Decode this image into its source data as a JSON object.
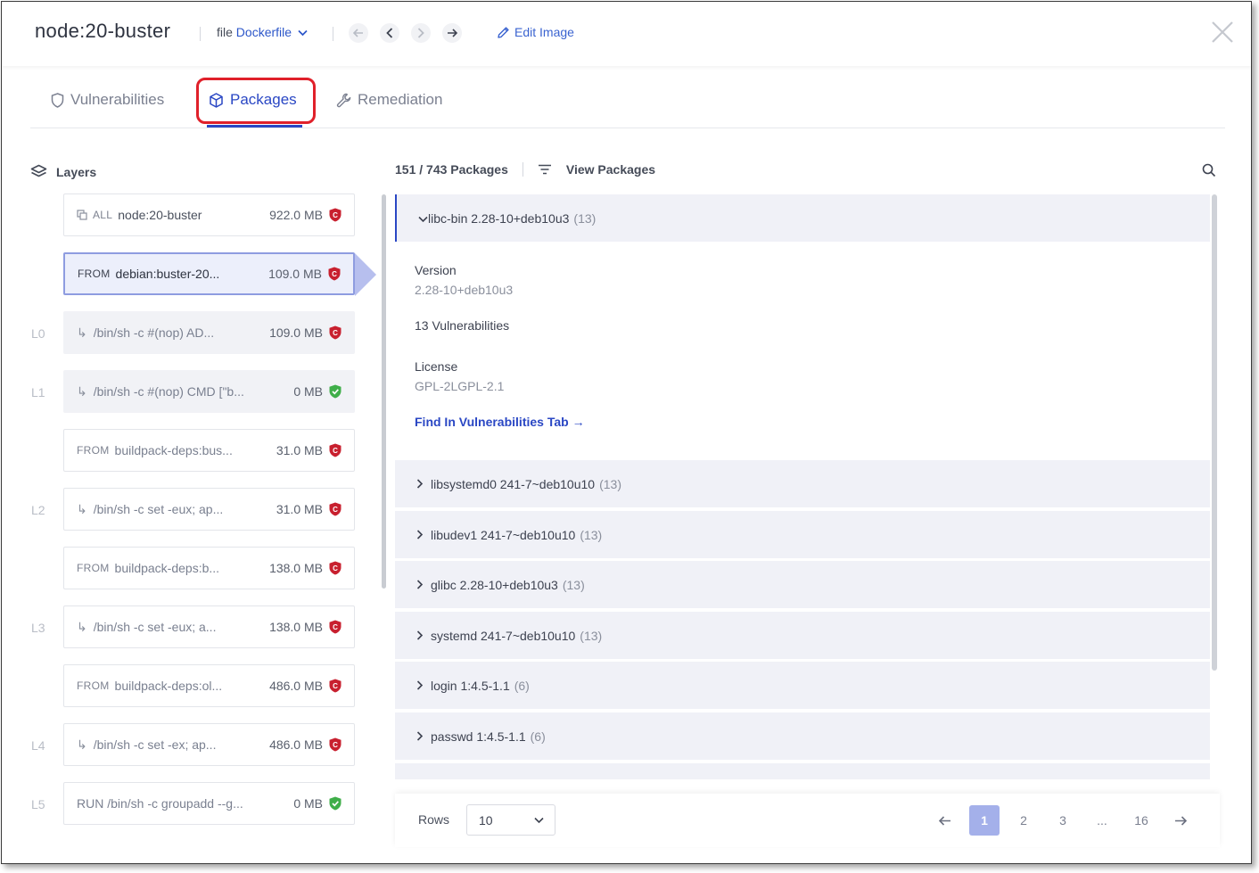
{
  "header": {
    "title": "node:20-buster",
    "file_prefix": "file",
    "file_name": "Dockerfile",
    "edit_image": "Edit Image"
  },
  "tabs": [
    {
      "label": "Vulnerabilities",
      "active": false
    },
    {
      "label": "Packages",
      "active": true
    },
    {
      "label": "Remediation",
      "active": false
    }
  ],
  "layers": {
    "heading": "Layers",
    "items": [
      {
        "index": "",
        "prefix": "ALL",
        "command": "node:20-buster",
        "size": "922.0 MB",
        "status": "critical"
      },
      {
        "index": "",
        "prefix": "FROM",
        "command": "debian:buster-20...",
        "size": "109.0 MB",
        "status": "critical"
      },
      {
        "index": "L0",
        "prefix": "",
        "command": "/bin/sh -c #(nop) AD...",
        "size": "109.0 MB",
        "status": "critical"
      },
      {
        "index": "L1",
        "prefix": "",
        "command": "/bin/sh -c #(nop) CMD [\"b...",
        "size": "0 MB",
        "status": "ok"
      },
      {
        "index": "",
        "prefix": "FROM",
        "command": "buildpack-deps:bus...",
        "size": "31.0 MB",
        "status": "critical"
      },
      {
        "index": "L2",
        "prefix": "",
        "command": "/bin/sh -c set -eux; ap...",
        "size": "31.0 MB",
        "status": "critical"
      },
      {
        "index": "",
        "prefix": "FROM",
        "command": "buildpack-deps:b...",
        "size": "138.0 MB",
        "status": "critical"
      },
      {
        "index": "L3",
        "prefix": "",
        "command": "/bin/sh -c set -eux; a...",
        "size": "138.0 MB",
        "status": "critical"
      },
      {
        "index": "",
        "prefix": "FROM",
        "command": "buildpack-deps:ol...",
        "size": "486.0 MB",
        "status": "critical"
      },
      {
        "index": "L4",
        "prefix": "",
        "command": "/bin/sh -c set -ex; ap...",
        "size": "486.0 MB",
        "status": "critical"
      },
      {
        "index": "L5",
        "prefix": "",
        "command": "RUN /bin/sh -c groupadd --g...",
        "size": "0 MB",
        "status": "ok"
      }
    ]
  },
  "packages": {
    "count_label": "151 / 743 Packages",
    "view_label": "View Packages",
    "expanded": {
      "name": "libc-bin 2.28-10+deb10u3",
      "count": "(13)",
      "version_label": "Version",
      "version_value": "2.28-10+deb10u3",
      "vulns_label": "13 Vulnerabilities",
      "license_label": "License",
      "license_value": "GPL-2LGPL-2.1",
      "link": "Find In Vulnerabilities Tab →"
    },
    "rows": [
      {
        "name": "libsystemd0 241-7~deb10u10",
        "count": "(13)"
      },
      {
        "name": "libudev1 241-7~deb10u10",
        "count": "(13)"
      },
      {
        "name": "glibc 2.28-10+deb10u3",
        "count": "(13)"
      },
      {
        "name": "systemd 241-7~deb10u10",
        "count": "(13)"
      },
      {
        "name": "login 1:4.5-1.1",
        "count": "(6)"
      },
      {
        "name": "passwd 1:4.5-1.1",
        "count": "(6)"
      }
    ]
  },
  "pagination": {
    "rows_label": "Rows",
    "rows_value": "10",
    "pages": [
      "1",
      "2",
      "3",
      "...",
      "16"
    ],
    "current": "1"
  },
  "colors": {
    "accent": "#2a47c4",
    "critical": "#c8202f",
    "ok": "#3fae49",
    "highlight": "#e0202a"
  }
}
